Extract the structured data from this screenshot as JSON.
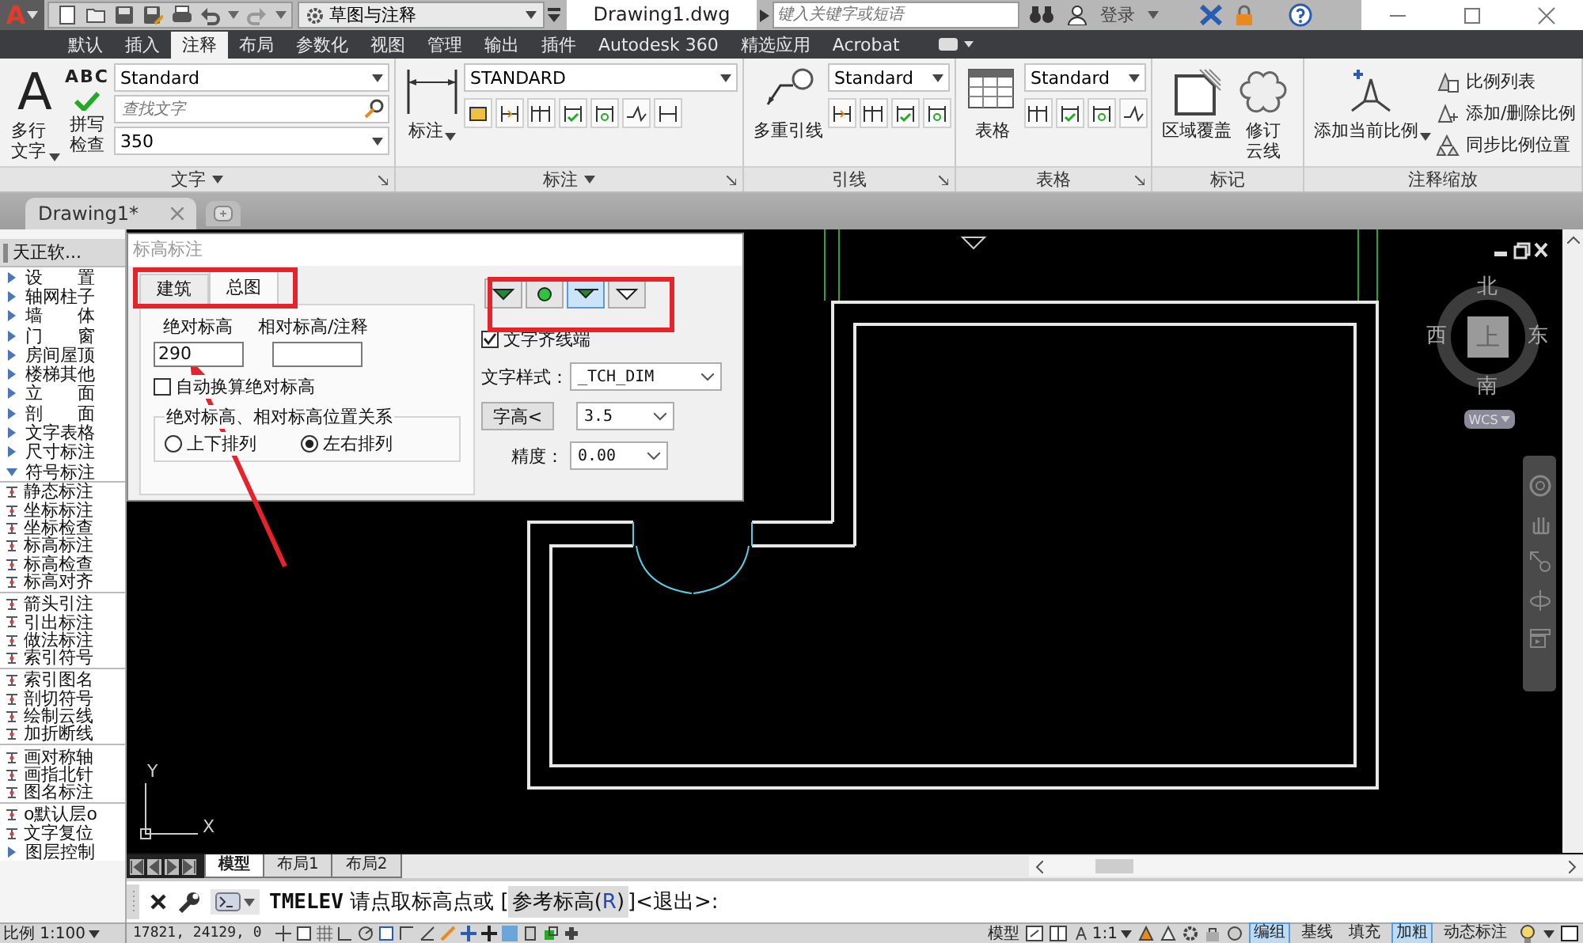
{
  "title_bar": {
    "logo": "A",
    "workspace": "草图与注释",
    "title": "Drawing1.dwg",
    "search": {
      "placeholder": "键入关键字或短语"
    },
    "sign_in": "登录"
  },
  "ribbon": {
    "tabs": [
      {
        "label": "默认",
        "selected": false
      },
      {
        "label": "插入",
        "selected": false
      },
      {
        "label": "注释",
        "selected": true
      },
      {
        "label": "布局",
        "selected": false
      },
      {
        "label": "参数化",
        "selected": false
      },
      {
        "label": "视图",
        "selected": false
      },
      {
        "label": "管理",
        "selected": false
      },
      {
        "label": "输出",
        "selected": false
      },
      {
        "label": "插件",
        "selected": false
      },
      {
        "label": "Autodesk 360",
        "selected": false
      },
      {
        "label": "精选应用",
        "selected": false
      },
      {
        "label": "Acrobat",
        "selected": false
      }
    ],
    "panels": [
      {
        "kind": "text",
        "title": "文字",
        "menu": true,
        "launcher": true,
        "buttons": [
          {
            "kind": "mtext",
            "glyph": "A",
            "label": "多行文字",
            "caret": true
          },
          {
            "kind": "spell",
            "glyph": "ABC",
            "label": "拼写检查",
            "caret": false
          }
        ],
        "fields": [
          {
            "kind": "combo",
            "value": "Standard"
          },
          {
            "kind": "search",
            "placeholder": "查找文字"
          },
          {
            "kind": "combo",
            "value": "350"
          }
        ]
      },
      {
        "kind": "dimension",
        "title": "标注",
        "menu": true,
        "launcher": true,
        "buttons": [
          {
            "kind": "dim",
            "label": "标注",
            "caret": true
          }
        ],
        "fields": [
          {
            "kind": "combo",
            "value": "STANDARD"
          }
        ]
      },
      {
        "kind": "leader",
        "title": "引线",
        "menu": false,
        "launcher": true,
        "buttons": [
          {
            "kind": "leader",
            "label": "多重引线",
            "caret": false
          }
        ],
        "fields": [
          {
            "kind": "combo",
            "value": "Standard"
          }
        ]
      },
      {
        "kind": "table",
        "title": "表格",
        "menu": false,
        "launcher": true,
        "buttons": [
          {
            "kind": "table",
            "label": "表格",
            "caret": false
          }
        ],
        "fields": [
          {
            "kind": "combo",
            "value": "Standard"
          }
        ]
      },
      {
        "kind": "markup",
        "title": "标记",
        "menu": false,
        "launcher": false,
        "buttons": [
          {
            "kind": "wipeout",
            "label": "区域覆盖",
            "caret": false
          },
          {
            "kind": "cloud",
            "label": "修订云线",
            "caret": false
          }
        ]
      },
      {
        "kind": "scale",
        "title": "注释缩放",
        "menu": false,
        "launcher": false,
        "buttons": [
          {
            "kind": "scale",
            "label": "添加当前比例",
            "caret": true
          }
        ],
        "links": [
          {
            "kind": "list",
            "label": "比例列表"
          },
          {
            "kind": "addremove",
            "label": "添加/删除比例"
          },
          {
            "kind": "sync",
            "label": "同步比例位置"
          }
        ]
      }
    ]
  },
  "document_tabs": [
    {
      "label": "Drawing1*",
      "selected": true
    }
  ],
  "sidebar": {
    "title": "天正软...",
    "items": [
      {
        "label": "设　　置",
        "expanded": false
      },
      {
        "label": "轴网柱子",
        "expanded": false
      },
      {
        "label": "墙　　体",
        "expanded": false
      },
      {
        "label": "门　　窗",
        "expanded": false
      },
      {
        "label": "房间屋顶",
        "expanded": false
      },
      {
        "label": "楼梯其他",
        "expanded": false
      },
      {
        "label": "立　　面",
        "expanded": false
      },
      {
        "label": "剖　　面",
        "expanded": false
      },
      {
        "label": "文字表格",
        "expanded": false
      },
      {
        "label": "尺寸标注",
        "expanded": false
      },
      {
        "label": "符号标注",
        "expanded": true,
        "children": [
          {
            "kind": "command",
            "label": "静态标注"
          },
          {
            "kind": "command",
            "label": "坐标标注"
          },
          {
            "kind": "command",
            "label": "坐标检查"
          },
          {
            "kind": "command",
            "label": "标高标注"
          },
          {
            "kind": "command",
            "label": "标高检查"
          },
          {
            "kind": "command",
            "label": "标高对齐"
          },
          {
            "kind": "separator"
          },
          {
            "kind": "command",
            "label": "箭头引注"
          },
          {
            "kind": "command",
            "label": "引出标注"
          },
          {
            "kind": "command",
            "label": "做法标注"
          },
          {
            "kind": "command",
            "label": "索引符号"
          },
          {
            "kind": "separator"
          },
          {
            "kind": "command",
            "label": "索引图名"
          },
          {
            "kind": "command",
            "label": "剖切符号"
          },
          {
            "kind": "command",
            "label": "绘制云线"
          },
          {
            "kind": "command",
            "label": "加折断线"
          },
          {
            "kind": "separator"
          },
          {
            "kind": "command",
            "label": "画对称轴"
          },
          {
            "kind": "command",
            "label": "画指北针"
          },
          {
            "kind": "command",
            "label": "图名标注"
          },
          {
            "kind": "separator"
          },
          {
            "kind": "command",
            "label": "o默认层o"
          },
          {
            "kind": "command",
            "label": "文字复位"
          }
        ]
      },
      {
        "label": "图层控制",
        "expanded": false
      }
    ]
  },
  "elevation_dialog": {
    "title": "标高标注",
    "tabs": [
      {
        "label": "建筑",
        "selected": false
      },
      {
        "label": "总图",
        "selected": true
      }
    ],
    "absolute": {
      "label": "绝对标高",
      "value": "290"
    },
    "relative": {
      "label": "相对标高/注释"
    },
    "auto_convert": {
      "label": "自动换算绝对标高",
      "checked": false
    },
    "arrangement": {
      "title": "绝对标高、相对标高位置关系",
      "options": [
        {
          "label": "上下排列",
          "selected": false
        },
        {
          "label": "左右排列",
          "selected": true
        }
      ]
    },
    "symbols": [
      {
        "kind": "filled",
        "selected": false
      },
      {
        "kind": "dot",
        "selected": false
      },
      {
        "kind": "filled_line",
        "selected": true
      },
      {
        "kind": "hollow",
        "selected": false
      }
    ],
    "align_text": {
      "label": "文字齐线端",
      "checked": true
    },
    "text_style": {
      "label": "文字样式：",
      "value": "_TCH_DIM"
    },
    "text_height": {
      "button": "字高<",
      "value": "3.5"
    },
    "precision": {
      "label": "精度：",
      "value": "0.00"
    }
  },
  "canvas": {
    "ucs": {
      "x": "X",
      "y": "Y"
    },
    "viewcube": {
      "north": "北",
      "south": "南",
      "west": "西",
      "east": "东",
      "face": "上",
      "system": "WCS"
    }
  },
  "layout_tabs": [
    {
      "label": "模型",
      "selected": true
    },
    {
      "label": "布局1",
      "selected": false
    },
    {
      "label": "布局2",
      "selected": false
    }
  ],
  "command_line": {
    "command": "TMELEV",
    "prompt": "请点取标高点或 [",
    "option": "参考标高(",
    "option_key": "R",
    "option_close": ")",
    "tail": "]<退出>:"
  },
  "status_bar": {
    "scale": "比例 1:100",
    "coords": "17821, 24129, 0",
    "space": "模型",
    "annotation_scale": "1:1",
    "toggles": [
      {
        "label": "编组",
        "on": true
      },
      {
        "label": "基线",
        "on": false
      },
      {
        "label": "填充",
        "on": false
      },
      {
        "label": "加粗",
        "on": true
      },
      {
        "label": "动态标注",
        "on": false
      }
    ]
  }
}
